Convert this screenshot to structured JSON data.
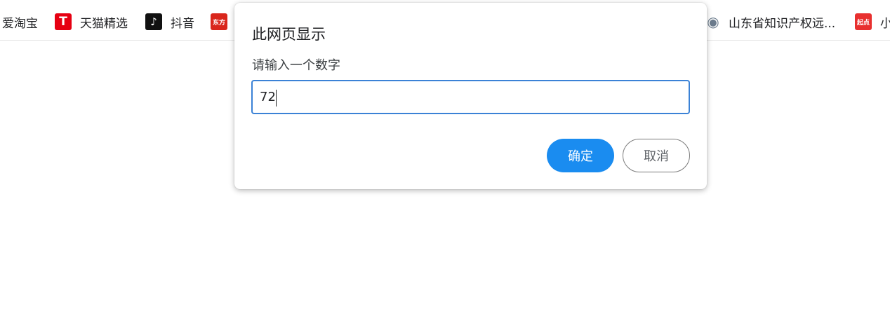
{
  "bookmarks": [
    {
      "label": "爱淘宝",
      "icon": "none"
    },
    {
      "label": "天猫精选",
      "icon": "tmall-icon",
      "icon_text": "T",
      "color": "#e60012"
    },
    {
      "label": "抖音",
      "icon": "douyin-icon",
      "icon_text": "♪",
      "color": "#111111"
    },
    {
      "label": "",
      "icon": "dongfang-icon",
      "icon_text": "东方",
      "color": "#d9261c"
    },
    {
      "label": "山东省知识产权远...",
      "icon": "emblem-icon",
      "icon_text": "◉",
      "color": "#6b7b8c"
    },
    {
      "label": "小",
      "icon": "qidian-icon",
      "icon_text": "起点",
      "color": "#e8302f"
    }
  ],
  "dialog": {
    "title": "此网页显示",
    "message": "请输入一个数字",
    "input_value": "72",
    "ok_label": "确定",
    "cancel_label": "取消"
  },
  "colors": {
    "accent": "#1a8cf0",
    "input_border": "#3b82d6"
  }
}
